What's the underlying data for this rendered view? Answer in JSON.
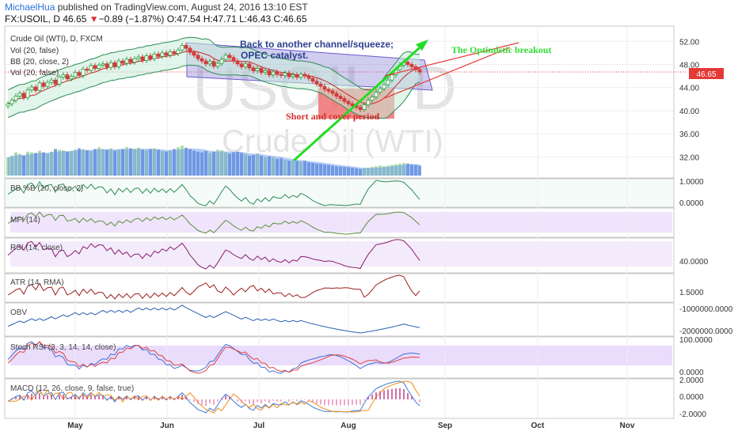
{
  "header": {
    "author": "MichaelHua",
    "published": " published on TradingView.com, August 24, 2016 13:10 EST",
    "symbol": "FX:USOIL, D",
    "price": "46.65",
    "change_arrow": "▼",
    "change": "−0.89 (−1.87%)",
    "ohlc": "O:47.54 H:47.71 L:46.43 C:46.65"
  },
  "legend": {
    "title": "Crude Oil (WTI), D, FXCM",
    "items": [
      "Vol (20, false)",
      "BB (20, close, 2)",
      "Vol (20, false)"
    ]
  },
  "watermark": {
    "symbol": "USOIL, D",
    "name": "Crude Oil (WTI)"
  },
  "annotations": {
    "channel": "Back to another channel/squeeze;",
    "catalyst": "OPEC catalyst.",
    "short": "Short and cover period",
    "breakout": "The Optimistic breakout"
  },
  "indicators": {
    "bb": "BB %B (20, close, 2)",
    "mfi": "MFI (14)",
    "rsi": "RSI (14, close)",
    "atr": "ATR (14, RMA)",
    "obv": "OBV",
    "stoch": "Stoch RSI (3, 3, 14, 14, close)",
    "macd": "MACD (12, 26, close, 9, false, true)"
  },
  "price_badge": "46.65",
  "colors": {
    "up": "#26a041",
    "down": "#d23b3b",
    "bb": "#2e8b57",
    "ma": "#c62828",
    "vol": "#4a7fd6",
    "arrow": "#22dd22"
  },
  "chart_data": {
    "type": "candlestick",
    "title": "Crude Oil (WTI), D, FXCM",
    "x_ticks": [
      "May",
      "Jun",
      "Jul",
      "Aug",
      "Sep",
      "Oct",
      "Nov"
    ],
    "y_ticks": [
      "52.00",
      "48.00",
      "44.00",
      "40.00",
      "36.00",
      "32.00"
    ],
    "ylim": [
      28.5,
      54.5
    ],
    "panes": {
      "bb_pb": {
        "ticks": [
          "1.0000",
          "0.0000"
        ]
      },
      "rsi": {
        "ticks": [
          "40.0000"
        ]
      },
      "atr": {
        "ticks": [
          "1.5000"
        ]
      },
      "obv": {
        "ticks": [
          "-1000000.0000",
          "-2000000.0000"
        ]
      },
      "stoch": {
        "ticks": [
          "100.0000",
          "0.0000"
        ]
      },
      "macd": {
        "ticks": [
          "2.0000",
          "0.0000",
          "-2.0000"
        ]
      }
    },
    "close": [
      41.2,
      41.8,
      42.5,
      43.0,
      42.3,
      43.6,
      44.1,
      43.5,
      44.8,
      44.2,
      44.9,
      45.3,
      44.6,
      45.8,
      46.2,
      45.5,
      45.9,
      46.6,
      46.1,
      47.2,
      47.0,
      47.8,
      47.3,
      47.9,
      48.1,
      47.5,
      48.3,
      47.6,
      48.6,
      48.2,
      48.9,
      48.4,
      49.0,
      49.3,
      48.7,
      49.5,
      49.0,
      49.8,
      49.4,
      50.0,
      49.6,
      50.2,
      49.9,
      50.5,
      51.3,
      50.8,
      50.1,
      49.6,
      49.0,
      48.6,
      48.1,
      48.5,
      47.7,
      48.2,
      48.9,
      49.6,
      49.2,
      48.6,
      48.1,
      47.6,
      48.1,
      47.4,
      46.9,
      47.3,
      46.6,
      46.9,
      46.2,
      46.7,
      46.3,
      46.1,
      46.5,
      45.9,
      46.2,
      45.8,
      46.3,
      46.0,
      45.6,
      45.1,
      44.6,
      44.2,
      43.7,
      43.4,
      43.0,
      42.5,
      42.1,
      41.6,
      41.2,
      40.9,
      40.6,
      40.2,
      41.0,
      41.8,
      42.4,
      43.2,
      43.8,
      44.5,
      45.3,
      46.2,
      47.1,
      47.9,
      48.4,
      48.0,
      47.6,
      47.1,
      46.7
    ],
    "volume": [
      0.55,
      0.6,
      0.7,
      0.65,
      0.6,
      0.72,
      0.7,
      0.68,
      0.75,
      0.7,
      0.66,
      0.72,
      0.8,
      0.78,
      0.76,
      0.72,
      0.74,
      0.78,
      0.82,
      0.8,
      0.76,
      0.74,
      0.8,
      0.85,
      0.8,
      0.78,
      0.82,
      0.75,
      0.78,
      0.8,
      0.86,
      0.82,
      0.8,
      0.84,
      0.78,
      0.76,
      0.8,
      0.82,
      0.78,
      0.74,
      0.72,
      0.76,
      0.8,
      0.86,
      0.9,
      0.84,
      0.8,
      0.75,
      0.72,
      0.7,
      0.74,
      0.68,
      0.72,
      0.78,
      0.76,
      0.7,
      0.66,
      0.7,
      0.72,
      0.68,
      0.64,
      0.6,
      0.62,
      0.66,
      0.6,
      0.55,
      0.58,
      0.54,
      0.5,
      0.52,
      0.48,
      0.45,
      0.46,
      0.44,
      0.42,
      0.44,
      0.4,
      0.38,
      0.36,
      0.35,
      0.33,
      0.32,
      0.3,
      0.28,
      0.27,
      0.26,
      0.25,
      0.24,
      0.22,
      0.2,
      0.22,
      0.24,
      0.26,
      0.28,
      0.3,
      0.28,
      0.3,
      0.32,
      0.34,
      0.36,
      0.38,
      0.36,
      0.34,
      0.32,
      0.3
    ]
  }
}
